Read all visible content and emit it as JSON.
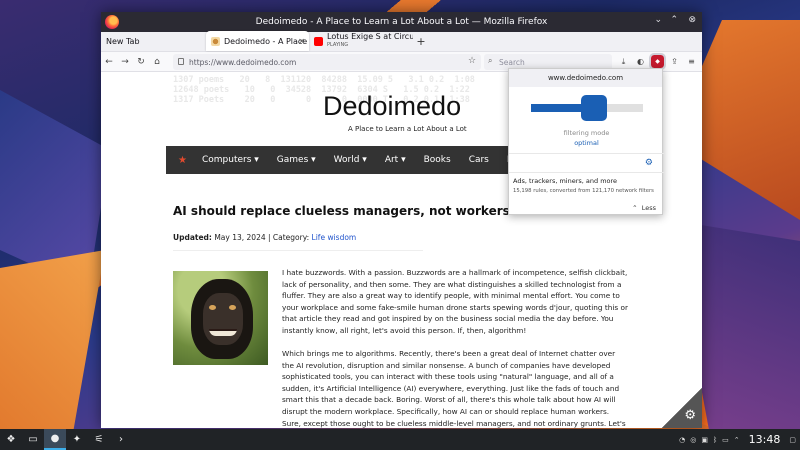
{
  "window": {
    "title": "Dedoimedo - A Place to Learn a Lot About a Lot — Mozilla Firefox"
  },
  "tabs": [
    {
      "label": "New Tab"
    },
    {
      "label": "Dedoimedo - A Place to Le"
    },
    {
      "label": "Lotus Exige S at Circuit de",
      "sub": "PLAYING"
    }
  ],
  "toolbar": {
    "url": "https://www.dedoimedo.com",
    "search_placeholder": "Search"
  },
  "page": {
    "background_text": "1307 poems   20   8  131120  84288  15.09 5   3.1 0.2  1:08\n12648 poets   10   0  34528  13792  6304 S   1.5 0.2  1:22\n1317 Poets    20   0      0      0  0000 T   0.2 0.1  1:38",
    "site_title": "Dedoimedo",
    "tagline": "A Place to Learn a Lot About a Lot",
    "nav": [
      "Computers ▾",
      "Games ▾",
      "World ▾",
      "Art ▾",
      "Books",
      "Cars",
      "Ph"
    ],
    "article_title": "AI should replace clueless managers, not workers",
    "updated_label": "Updated:",
    "updated_date": "May 13, 2024 | Category:",
    "category": "Life wisdom",
    "para1": "I hate buzzwords. With a passion. Buzzwords are a hallmark of incompetence, selfish clickbait, lack of personality, and then some. They are what distinguishes a skilled technologist from a fluffer. They are also a great way to identify people, with minimal mental effort. You come to your workplace and some fake-smile human drone starts spewing words d'jour, quoting this or that article they read and got inspired by on the business social media the day before. You instantly know, all right, let's avoid this person. If, then, algorithm!",
    "para2": "Which brings me to algorithms. Recently, there's been a great deal of Internet chatter over the AI revolution, disruption and similar nonsense. A bunch of companies have developed sophisticated tools, you can interact with these tools using \"natural\" language, and all of a sudden, it's Artificial Intelligence (AI) everywhere, everything. Just like the fads of touch and smart this that a decade back. Boring. Worst of all, there's this whole talk about how AI will disrupt the modern workplace. Specifically, how AI can or should replace human workers. Sure, except those ought to be clueless middle-level managers, and not ordinary grunts. Let's elaborate."
  },
  "ublock": {
    "domain": "www.dedoimedo.com",
    "filter_level": 0.56,
    "mode_label": "filtering mode",
    "mode_value": "optimal",
    "stats_title": "Ads, trackers, miners, and more",
    "stats_detail": "15,198 rules, converted from 121,170 network filters",
    "less_label": "Less"
  },
  "taskbar": {
    "clock": "13:48"
  },
  "colors": {
    "accent": "#1a5fb4",
    "nav_bg": "#333333",
    "link": "#2255cc"
  }
}
